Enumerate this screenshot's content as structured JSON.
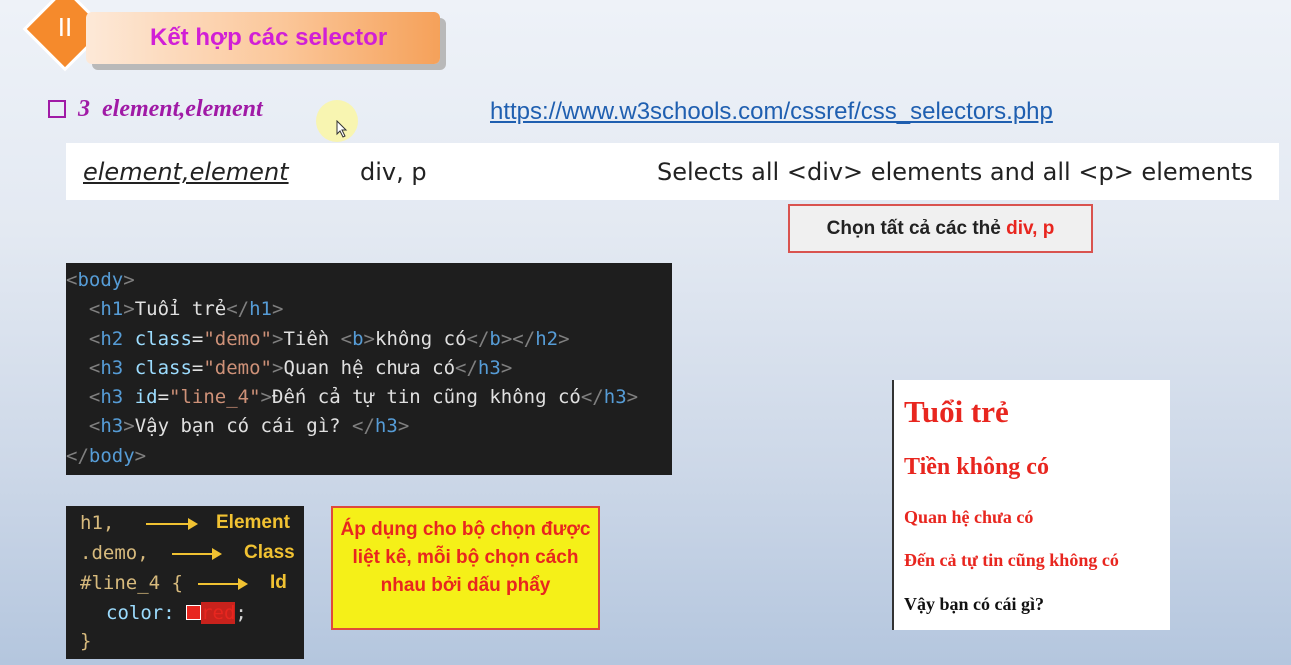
{
  "header": {
    "section_number": "II",
    "title": "Kết hợp các selector"
  },
  "subtitle": {
    "number": "3",
    "text": "element,element"
  },
  "reference_link": "https://www.w3schools.com/cssref/css_selectors.php",
  "selector_row": {
    "name": "element,element",
    "example": "div, p",
    "description": "Selects all <div> elements and all <p> elements"
  },
  "note": {
    "prefix": "Chọn tất cả các thẻ",
    "highlight": "div, p"
  },
  "html_code": {
    "lines": [
      [
        "<",
        "body",
        ">"
      ],
      [
        "h1",
        "Tuổi trẻ"
      ],
      [
        "h2",
        "class",
        "\"demo\"",
        "Tiền ",
        "b",
        "không có"
      ],
      [
        "h3",
        "class",
        "\"demo\"",
        "Quan hệ chưa có"
      ],
      [
        "h3",
        "id",
        "\"line_4\"",
        "Đến cả tự tin cũng không có"
      ],
      [
        "h3",
        "Vậy bạn có cái gì? "
      ],
      [
        "</",
        "body",
        ">"
      ]
    ]
  },
  "css_legend": {
    "selectors": [
      "h1,",
      ".demo,",
      "#line_4 {"
    ],
    "labels": [
      "Element",
      "Class",
      "Id"
    ],
    "property": "color:",
    "value": "red",
    "closing": "}"
  },
  "explanation": "Áp dụng cho bộ chọn được liệt kê, mỗi bộ chọn cách nhau bởi dấu phẩy",
  "preview": {
    "h1": "Tuổi trẻ",
    "h2": "Tiền không có",
    "h3_1": "Quan hệ chưa có",
    "h3_2": "Đến cả tự tin cũng không có",
    "h3_3": "Vậy bạn có cái gì?"
  },
  "colors": {
    "accent_orange": "#f58a2c",
    "title_magenta": "#d11fd6",
    "subtitle_purple": "#a01aa6",
    "link_blue": "#1f5fb0",
    "red": "#e8261f",
    "yellow": "#f5f018"
  }
}
